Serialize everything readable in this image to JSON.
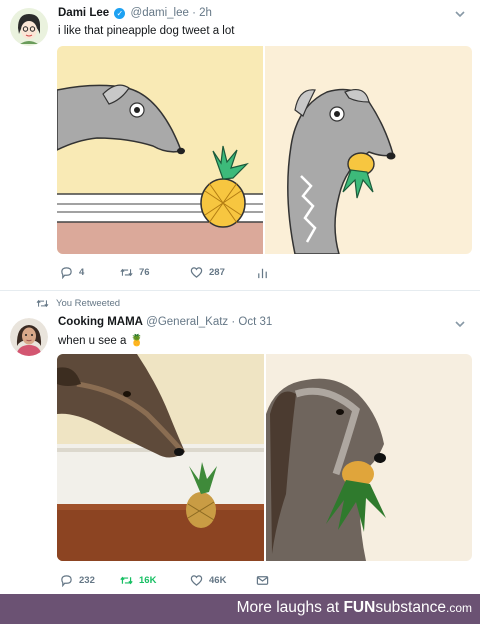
{
  "tweet1": {
    "name": "Dami Lee",
    "handle": "@dami_lee",
    "separator": "·",
    "time": "2h",
    "text": "i like that pineapple dog tweet a lot",
    "replies": "4",
    "retweets": "76",
    "likes": "287"
  },
  "tweet2": {
    "retweeted_by": "You Retweeted",
    "name": "Cooking MAMA",
    "handle": "@General_Katz",
    "separator": "·",
    "time": "Oct 31",
    "text": "when u see a",
    "text_emoji": "🍍",
    "replies": "232",
    "retweets": "16K",
    "likes": "46K",
    "retweet_color": "#17bf63"
  },
  "icons": [
    "verified-badge-icon",
    "chevron-down-icon",
    "reply-icon",
    "retweet-icon",
    "like-icon",
    "analytics-icon",
    "message-icon",
    "pineapple-emoji-icon"
  ],
  "footer": {
    "prefix": "More laughs at",
    "brand_fun": "FUN",
    "brand_substance": "substance",
    "domain": ".com",
    "background": "#6b5273"
  }
}
